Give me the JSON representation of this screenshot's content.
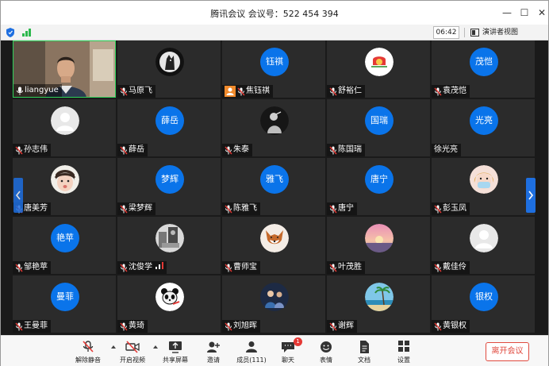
{
  "window": {
    "title": "腾讯会议 会议号：522 454 394",
    "min_glyph": "—",
    "max_glyph": "☐",
    "close_glyph": "✕"
  },
  "infobar": {
    "time": "06:42",
    "speaker_view_label": "演讲者视图"
  },
  "participants": [
    {
      "name": "liangyue",
      "type": "video",
      "mic": "on"
    },
    {
      "name": "马原飞",
      "type": "pic",
      "pic": "wolf",
      "mic": "muted"
    },
    {
      "name": "焦钰祺",
      "type": "avatar",
      "avatar_text": "钰祺",
      "mic": "muted",
      "user_icon": true
    },
    {
      "name": "舒裕仁",
      "type": "pic",
      "pic": "red-badge",
      "mic": "muted"
    },
    {
      "name": "袁茂恺",
      "type": "avatar",
      "avatar_text": "茂恺",
      "mic": "muted"
    },
    {
      "name": "孙志伟",
      "type": "pic",
      "pic": "default-gray",
      "mic": "muted"
    },
    {
      "name": "薛岳",
      "type": "avatar",
      "avatar_text": "薛岳",
      "mic": "muted"
    },
    {
      "name": "朱泰",
      "type": "pic",
      "pic": "statue",
      "mic": "muted"
    },
    {
      "name": "陈国瑞",
      "type": "avatar",
      "avatar_text": "国瑞",
      "mic": "muted"
    },
    {
      "name": "徐光亮",
      "type": "avatar",
      "avatar_text": "光亮",
      "mic": "none"
    },
    {
      "name": "唐美芳",
      "type": "pic",
      "pic": "girl",
      "mic": "muted"
    },
    {
      "name": "梁梦辉",
      "type": "avatar",
      "avatar_text": "梦辉",
      "mic": "muted"
    },
    {
      "name": "陈雅飞",
      "type": "avatar",
      "avatar_text": "雅飞",
      "mic": "muted"
    },
    {
      "name": "唐宁",
      "type": "avatar",
      "avatar_text": "唐宁",
      "mic": "muted"
    },
    {
      "name": "彭玉凤",
      "type": "pic",
      "pic": "cartoon-mask",
      "mic": "muted"
    },
    {
      "name": "邹艳苹",
      "type": "avatar",
      "avatar_text": "艳苹",
      "mic": "muted"
    },
    {
      "name": "沈俊学",
      "type": "pic",
      "pic": "bw-photo",
      "mic": "muted",
      "signal": true
    },
    {
      "name": "曹师宝",
      "type": "pic",
      "pic": "fox",
      "mic": "muted"
    },
    {
      "name": "叶茂胜",
      "type": "pic",
      "pic": "sunset",
      "mic": "muted"
    },
    {
      "name": "戴佳伶",
      "type": "pic",
      "pic": "default-gray",
      "mic": "muted"
    },
    {
      "name": "王曼菲",
      "type": "avatar",
      "avatar_text": "曼菲",
      "mic": "muted"
    },
    {
      "name": "黄琦",
      "type": "pic",
      "pic": "panda",
      "mic": "muted"
    },
    {
      "name": "刘旭晖",
      "type": "pic",
      "pic": "night-people",
      "mic": "muted"
    },
    {
      "name": "谢辉",
      "type": "pic",
      "pic": "beach",
      "mic": "muted"
    },
    {
      "name": "黄银权",
      "type": "avatar",
      "avatar_text": "银权",
      "mic": "muted"
    }
  ],
  "toolbar": {
    "unmute": "解除静音",
    "start_video": "开启视频",
    "share_screen": "共享屏幕",
    "invite": "邀请",
    "members": "成员(111)",
    "chat": "聊天",
    "chat_badge": "1",
    "reactions": "表情",
    "docs": "文档",
    "settings": "设置",
    "leave": "离开会议"
  },
  "colors": {
    "avatar_blue": "#0a74ea",
    "active_border": "#2fd45a",
    "leave_red": "#e04a3f"
  }
}
